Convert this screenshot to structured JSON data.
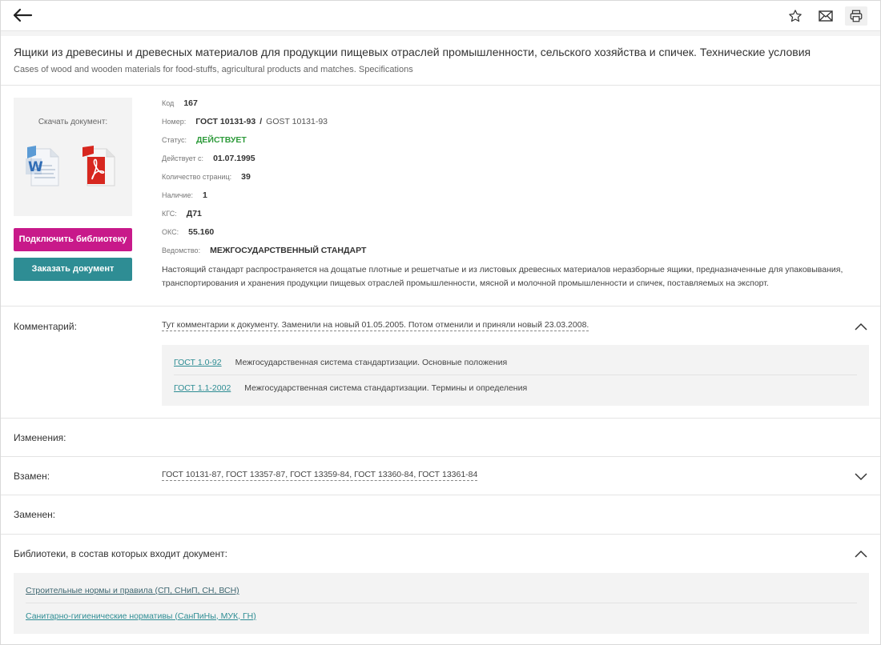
{
  "toolbar": {
    "back_icon": "arrow-left-icon",
    "favorite_icon": "star-icon",
    "mail_icon": "envelope-icon",
    "print_icon": "printer-icon"
  },
  "title": {
    "ru": "Ящики из древесины и древесных материалов для продукции пищевых отраслей промышленности, сельского хозяйства и спичек. Технические условия",
    "en": "Cases of wood and wooden materials for food-stuffs, agricultural products and matches. Specifications"
  },
  "download": {
    "label": "Скачать документ:",
    "formats": [
      "word-document-icon",
      "pdf-document-icon"
    ]
  },
  "buttons": {
    "connect_library": "Подключить библиотеку",
    "order_document": "Заказать документ"
  },
  "props": {
    "code_label": "Код",
    "code": "167",
    "number_label": "Номер:",
    "number": "ГОСТ 10131-93",
    "number_sep": "/",
    "number_alt": "GOST 10131-93",
    "status_label": "Статус:",
    "status": "ДЕЙСТВУЕТ",
    "valid_label": "Действует с:",
    "valid": "01.07.1995",
    "pages_label": "Количество страниц:",
    "pages": "39",
    "availability_label": "Наличие:",
    "availability": "1",
    "kgs_label": "КГС:",
    "kgs": "Д71",
    "oks_label": "ОКС:",
    "oks": "55.160",
    "agency_label": "Ведомство:",
    "agency": "МЕЖГОСУДАРСТВЕННЫЙ СТАНДАРТ",
    "description": "Настоящий стандарт распространяется на дощатые плотные и решетчатые и из листовых древесных материалов неразборные ящики, предназначенные для упаковывания, транспортирования и хранения продукции пищевых отраслей промышленности, мясной и молочной промышленности и спичек, поставляемых на экспорт."
  },
  "comment": {
    "label": "Комментарий:",
    "text": "Тут комментарии к документу. Заменили на новый 01.05.2005. Потом отменили и приняли новый 23.03.2008.",
    "items": [
      {
        "code": "ГОСТ 1.0-92",
        "desc": "Межгосударственная система стандартизации. Основные положения"
      },
      {
        "code": "ГОСТ 1.1-2002",
        "desc": "Межгосударственная система стандартизации. Термины и определения"
      }
    ]
  },
  "changes": {
    "label": "Изменения:"
  },
  "replaces": {
    "label": "Взамен:",
    "text": "ГОСТ 10131-87, ГОСТ 13357-87, ГОСТ 13359-84, ГОСТ 13360-84, ГОСТ 13361-84"
  },
  "replaced_by": {
    "label": "Заменен:"
  },
  "libraries": {
    "label": "Библиотеки, в состав которых входит документ:",
    "items": [
      "Строительные нормы и правила (СП, СНиП, СН, ВСН)",
      "Санитарно-гигиенические нормативы (СанПиНы, МУК, ГН)"
    ]
  },
  "colors": {
    "connect_button": "#c8198a",
    "order_button": "#2e8d94",
    "status_active": "#2e9b3b",
    "link": "#2e8d94"
  }
}
